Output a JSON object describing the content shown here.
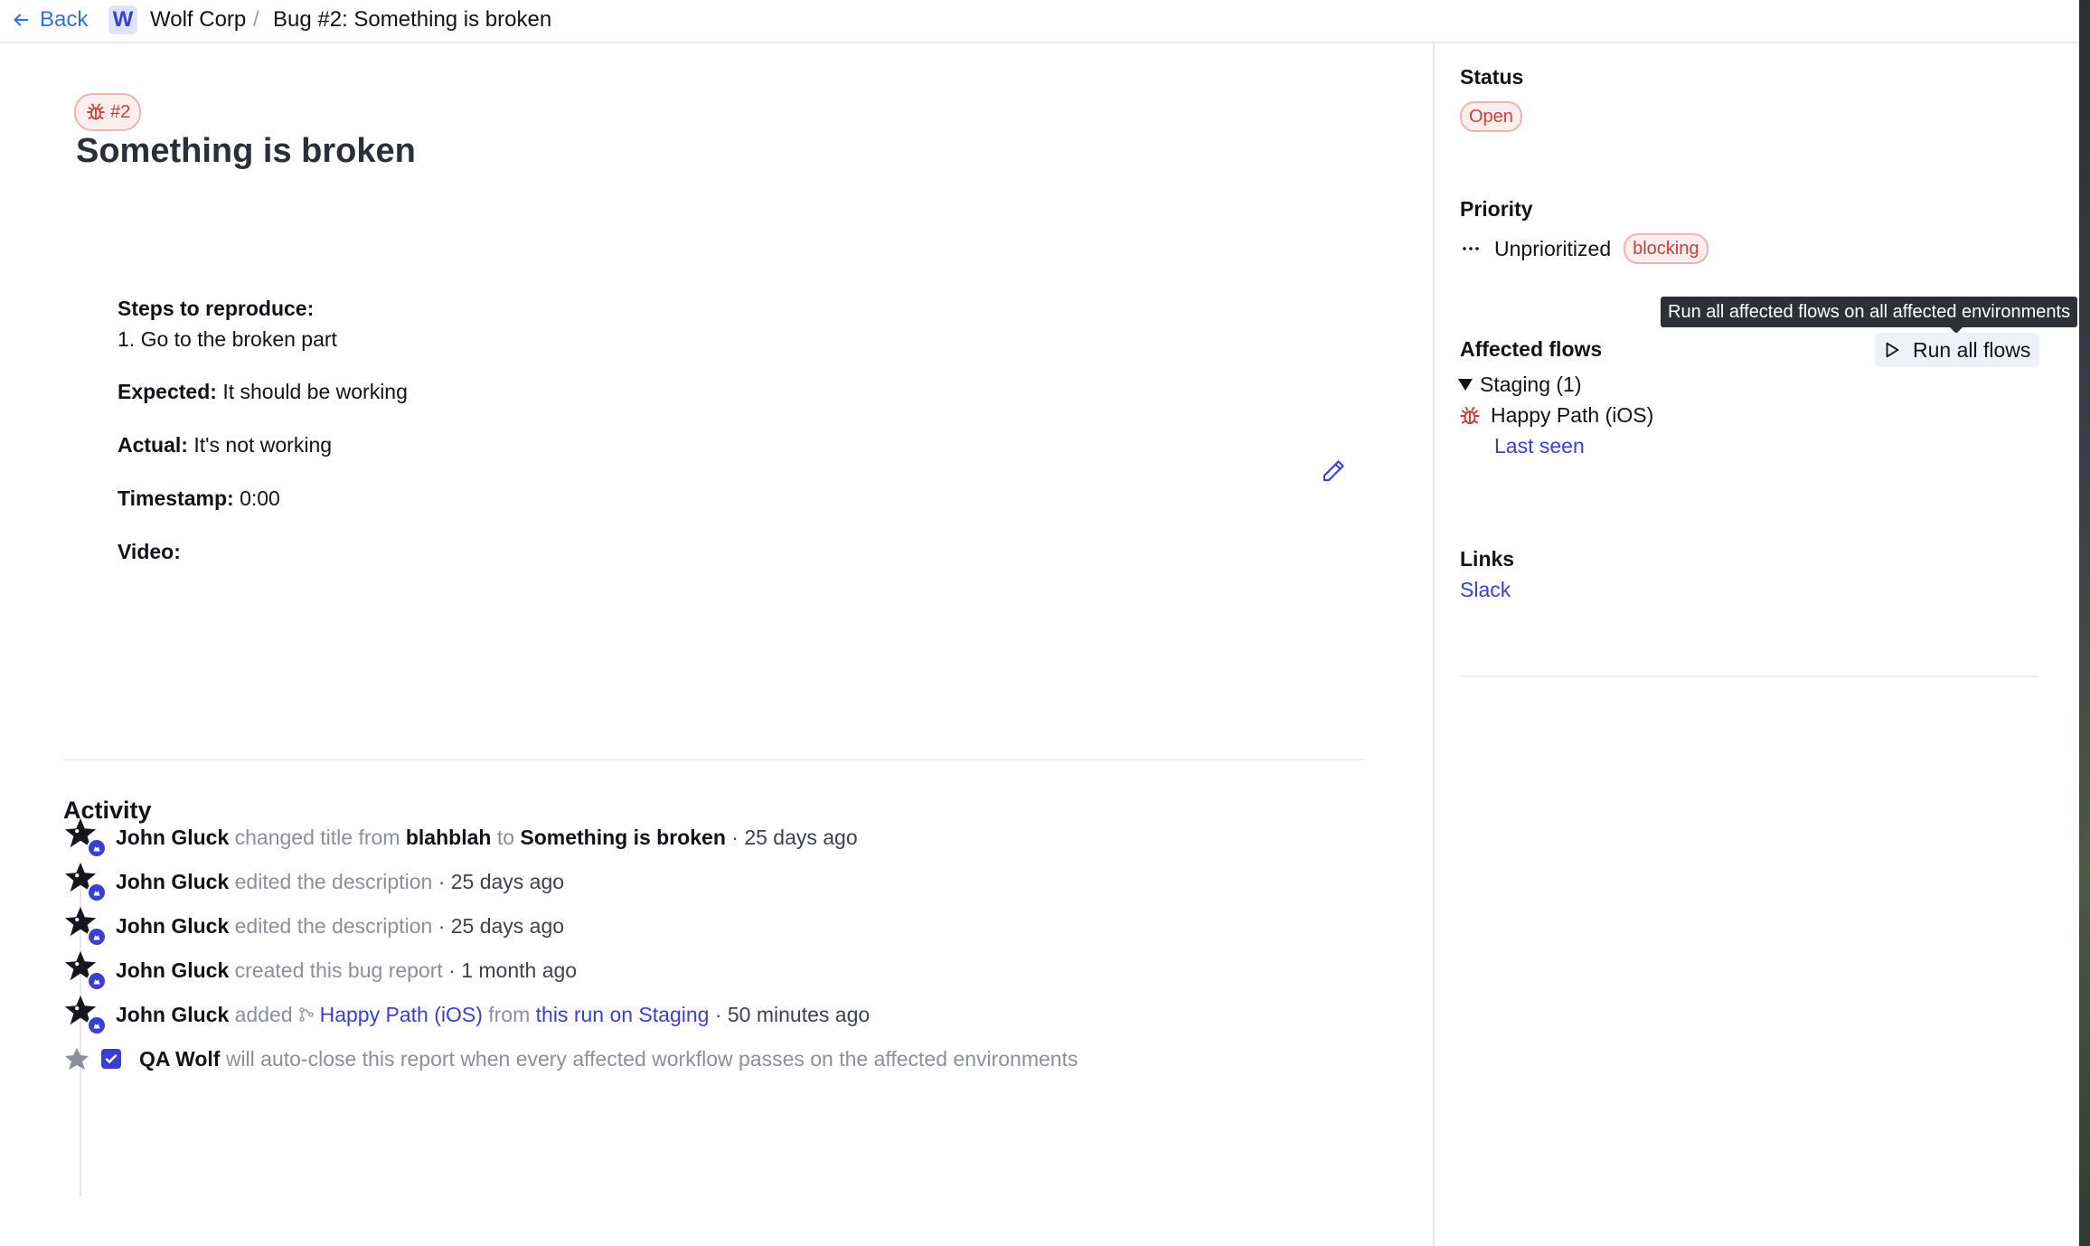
{
  "breadcrumb": {
    "back_label": "Back",
    "org_initial": "W",
    "org_name": "Wolf Corp",
    "separator": "/",
    "current": "Bug #2: Something is broken"
  },
  "bug": {
    "badge": "#2",
    "title": "Something is broken"
  },
  "description": {
    "steps_label": "Steps to reproduce:",
    "steps": [
      "1.  Go to the broken part"
    ],
    "expected_label": "Expected:",
    "expected_value": "It should be working",
    "actual_label": "Actual:",
    "actual_value": "It's not working",
    "timestamp_label": "Timestamp:",
    "timestamp_value": "0:00",
    "video_label": "Video:"
  },
  "activity": {
    "title": "Activity",
    "items": [
      {
        "actor": "John Gluck",
        "verb": "changed title from",
        "from": "blahblah",
        "to_word": "to",
        "to": "Something is broken",
        "time": "· 25 days ago"
      },
      {
        "actor": "John Gluck",
        "verb": "edited the description",
        "time": "· 25 days ago"
      },
      {
        "actor": "John Gluck",
        "verb": "edited the description",
        "time": "· 25 days ago"
      },
      {
        "actor": "John Gluck",
        "verb": "created this bug report",
        "time": "· 1 month ago"
      },
      {
        "actor": "John Gluck",
        "verb": "added",
        "flow": "Happy Path (iOS)",
        "from_word": "from",
        "run_link": "this run on Staging",
        "time": "· 50 minutes ago"
      }
    ],
    "auto_close": {
      "actor": "QA Wolf",
      "text": "will auto-close this report when every affected workflow passes on the affected environments",
      "checked": true
    }
  },
  "sidebar": {
    "status_label": "Status",
    "status_value": "Open",
    "priority_label": "Priority",
    "priority_value": "Unprioritized",
    "priority_tag": "blocking",
    "affected_flows_label": "Affected flows",
    "run_all_label": "Run all flows",
    "tooltip": "Run all affected flows on all affected environments",
    "environment": "Staging (1)",
    "flow_name": "Happy Path (iOS)",
    "last_seen": "Last seen",
    "links_label": "Links",
    "slack": "Slack"
  },
  "colors": {
    "accent": "#3b3fd1",
    "back_link": "#2f6fe8",
    "danger": "#d23b3b",
    "muted_text": "#8a8f99"
  },
  "icons": [
    "arrow-left-icon",
    "bug-icon",
    "pencil-icon",
    "wolf-avatar-icon",
    "play-icon",
    "more-dots-icon",
    "checkbox-icon",
    "flow-branch-icon"
  ]
}
